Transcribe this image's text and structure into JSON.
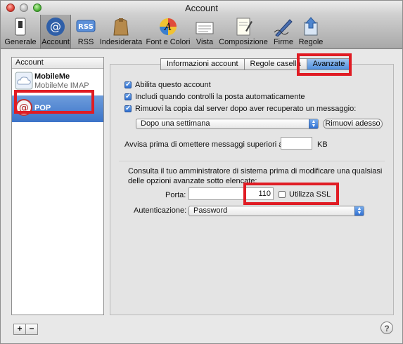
{
  "window": {
    "title": "Account"
  },
  "toolbar": {
    "items": [
      {
        "label": "Generale",
        "icon": "switch-icon"
      },
      {
        "label": "Account",
        "icon": "at-sign-icon",
        "selected": true
      },
      {
        "label": "RSS",
        "icon": "rss-icon"
      },
      {
        "label": "Indesiderata",
        "icon": "trash-bag-icon"
      },
      {
        "label": "Font e Colori",
        "icon": "font-colors-icon"
      },
      {
        "label": "Vista",
        "icon": "view-icon"
      },
      {
        "label": "Composizione",
        "icon": "compose-icon"
      },
      {
        "label": "Firme",
        "icon": "signature-pen-icon"
      },
      {
        "label": "Regole",
        "icon": "rules-icon"
      }
    ]
  },
  "sidebar": {
    "header": "Account",
    "accounts": [
      {
        "name": "MobileMe",
        "type": "MobileMe IMAP"
      },
      {
        "name": "POP",
        "type": ""
      }
    ],
    "add_label": "+",
    "remove_label": "−"
  },
  "tabs": [
    {
      "label": "Informazioni account"
    },
    {
      "label": "Regole casella"
    },
    {
      "label": "Avanzate",
      "active": true
    }
  ],
  "options": {
    "enable_account": "Abilita questo account",
    "include_check": "Includi quando controlli la posta automaticamente",
    "remove_copy": "Rimuovi la copia dal server dopo aver recuperato un messaggio:",
    "remove_after_value": "Dopo una settimana",
    "remove_now_button": "Rimuovi adesso",
    "warn_label": "Avvisa prima di omettere messaggi superiori a",
    "warn_value": "",
    "warn_unit": "KB"
  },
  "advanced": {
    "note": "Consulta il tuo amministratore di sistema prima di modificare una qualsiasi delle opzioni avanzate sotto elencate:",
    "port_label": "Porta:",
    "port_value": "110",
    "ssl_label": "Utilizza SSL",
    "auth_label": "Autenticazione:",
    "auth_value": "Password"
  },
  "help": "?",
  "colors": {
    "highlight_red": "#e01c24",
    "selection_blue": "#3b73c8"
  }
}
